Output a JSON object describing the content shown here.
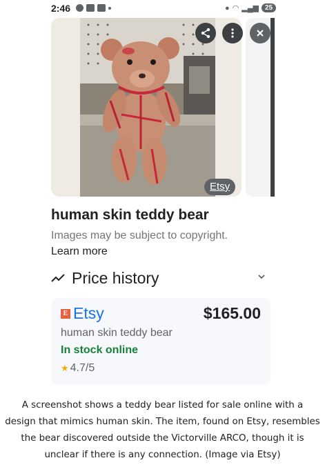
{
  "status_bar": {
    "time": "2:46",
    "battery": "25"
  },
  "image_viewer": {
    "source_badge": "Etsy",
    "icons": [
      "share-icon",
      "more-vert-icon",
      "close-icon"
    ]
  },
  "result": {
    "title": "human skin teddy bear",
    "copyright_notice": "Images may be subject to copyright.",
    "learn_more": "Learn more"
  },
  "price_history": {
    "label": "Price history"
  },
  "offer": {
    "merchant_logo_letter": "E",
    "merchant": "Etsy",
    "price": "$165.00",
    "product_title": "human skin teddy bear",
    "availability": "In stock online",
    "rating": "4.7/5",
    "colors": {
      "merchant": "#1a73e8",
      "availability": "#188038",
      "star": "#f9ab00",
      "logo": "#e8603c"
    }
  },
  "caption": {
    "line1": "A screenshot shows a teddy bear listed for sale online with a",
    "line2": "design that mimics human skin. The item, found on Etsy, resembles",
    "line3": "the bear discovered outside the Victorville ARCO, though it is",
    "line4": "unclear if there is any connection. (Image via Etsy)"
  }
}
